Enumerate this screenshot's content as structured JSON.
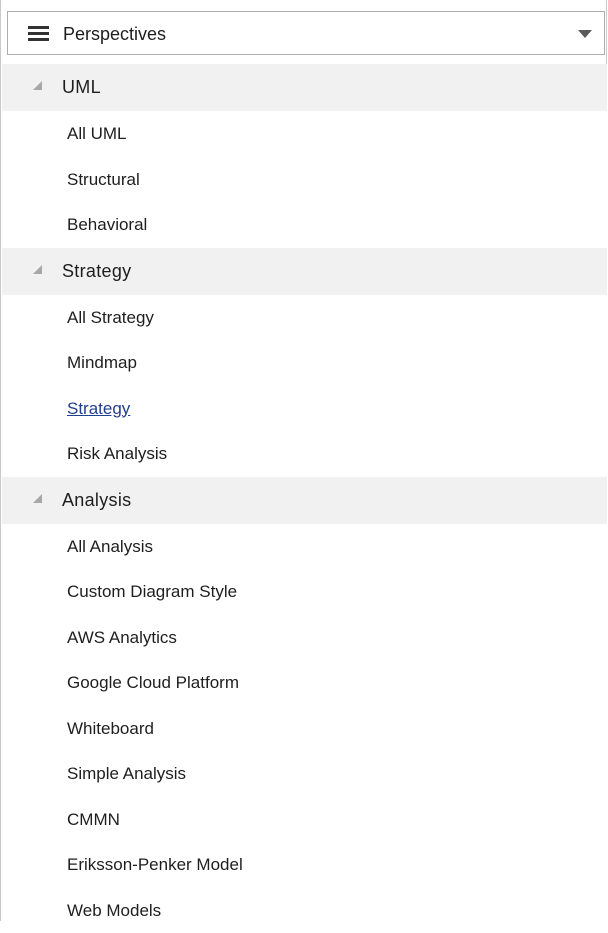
{
  "header": {
    "title": "Perspectives",
    "menu_icon": "hamburger-menu-icon",
    "dropdown_icon": "chevron-down-icon"
  },
  "groups": [
    {
      "label": "UML",
      "expanded": true,
      "items": [
        "All UML",
        "Structural",
        "Behavioral"
      ]
    },
    {
      "label": "Strategy",
      "expanded": true,
      "items": [
        "All Strategy",
        "Mindmap",
        "Strategy",
        "Risk Analysis"
      ]
    },
    {
      "label": "Analysis",
      "expanded": true,
      "items": [
        "All Analysis",
        "Custom Diagram Style",
        "AWS Analytics",
        "Google Cloud Platform",
        "Whiteboard",
        "Simple Analysis",
        "CMMN",
        "Eriksson-Penker Model",
        "Web Models"
      ]
    }
  ],
  "hovered_item": "Strategy",
  "colors": {
    "group_header_bg": "#f1f1f1",
    "link_color": "#1f3f8f",
    "text_color": "#1e1e1e"
  }
}
